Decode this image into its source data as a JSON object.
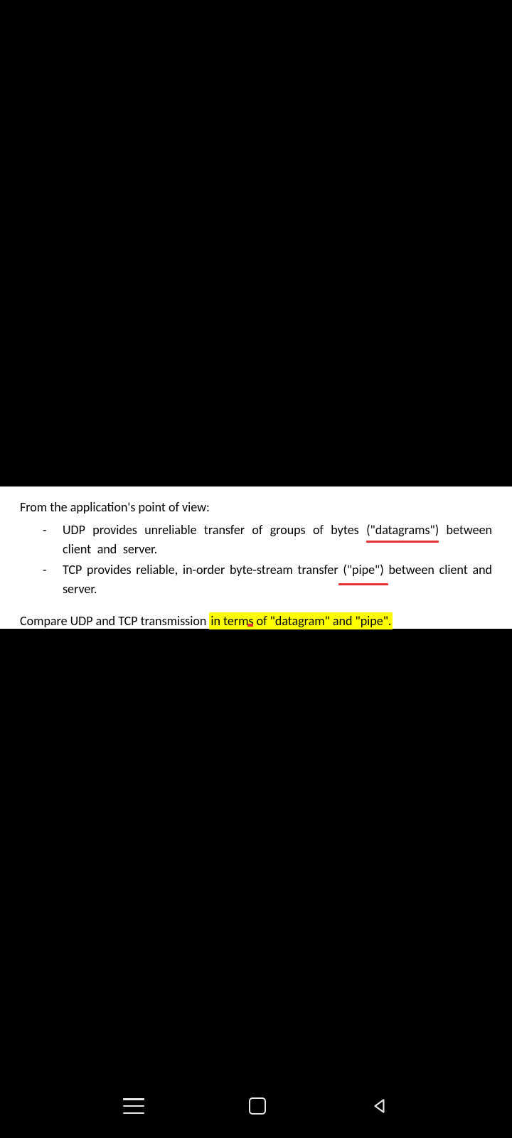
{
  "document": {
    "intro": "From the application's point of view:",
    "bullets": [
      {
        "marker": "-",
        "before": "UDP provides unreliable transfer of groups of bytes ",
        "underlined": "(\"datagrams\")",
        "after": " between client and server."
      },
      {
        "marker": "-",
        "before": "TCP provides reliable, in-order byte-stream transfer ",
        "underlined": "(\"pipe\")",
        "after": " between client and server."
      }
    ],
    "compare": {
      "before": "Compare UDP and TCP transmission ",
      "highlighted": "in terms of \"datagram\" and \"pipe\"."
    }
  },
  "nav": {
    "menu": "menu",
    "recent": "recent",
    "back": "back"
  }
}
